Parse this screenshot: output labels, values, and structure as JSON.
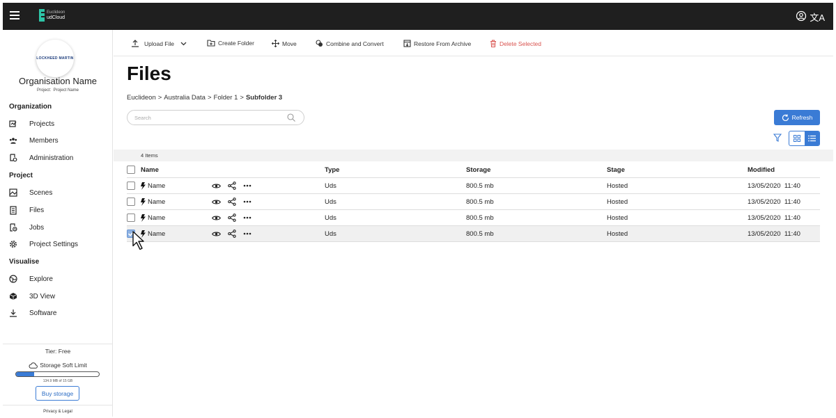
{
  "app": {
    "logo_small": "Euclideon",
    "logo_text": "udCloud"
  },
  "sidebar": {
    "org_logo_text": "LOCKHEED MARTIN",
    "org_name": "Organisation Name",
    "project_label": "Project:",
    "project_name": "Project Name",
    "sections": {
      "organization": "Organization",
      "project": "Project",
      "visualise": "Visualise"
    },
    "items": {
      "projects": "Projects",
      "members": "Members",
      "administration": "Administration",
      "scenes": "Scenes",
      "files": "Files",
      "jobs": "Jobs",
      "project_settings": "Project Settings",
      "explore": "Explore",
      "view3d": "3D View",
      "software": "Software"
    },
    "tier": "Tier: Free",
    "storage_label": "Storage Soft Limit",
    "storage_used_fraction": 0.22,
    "storage_text": "134.9 MB of 15 GB",
    "buy_storage": "Buy storage",
    "privacy": "Privacy & Legal"
  },
  "toolbar": {
    "upload": "Upload File",
    "create_folder": "Create Folder",
    "move": "Move",
    "combine": "Combine and Convert",
    "restore": "Restore From Archive",
    "delete": "Delete Selected"
  },
  "page": {
    "title": "Files",
    "breadcrumb": [
      "Euclideon",
      ">",
      "Australia Data",
      ">",
      "Folder 1",
      ">",
      "Subfolder 3"
    ],
    "search_placeholder": "Search",
    "refresh": "Refresh",
    "items_count": "4 Items"
  },
  "table": {
    "headers": {
      "name": "Name",
      "type": "Type",
      "storage": "Storage",
      "stage": "Stage",
      "modified": "Modified"
    },
    "rows": [
      {
        "name": "Name",
        "type": "Uds",
        "storage": "800.5 mb",
        "stage": "Hosted",
        "modified": "13/05/2020  11:40",
        "checked": false
      },
      {
        "name": "Name",
        "type": "Uds",
        "storage": "800.5 mb",
        "stage": "Hosted",
        "modified": "13/05/2020  11:40",
        "checked": false
      },
      {
        "name": "Name",
        "type": "Uds",
        "storage": "800.5 mb",
        "stage": "Hosted",
        "modified": "13/05/2020  11:40",
        "checked": false
      },
      {
        "name": "Name",
        "type": "Uds",
        "storage": "800.5 mb",
        "stage": "Hosted",
        "modified": "13/05/2020  11:40",
        "checked": true
      }
    ]
  },
  "colors": {
    "accent": "#3a7bd5",
    "danger": "#d9534f",
    "topbar": "#1f1f1f",
    "logo": "#2ec4a6"
  }
}
